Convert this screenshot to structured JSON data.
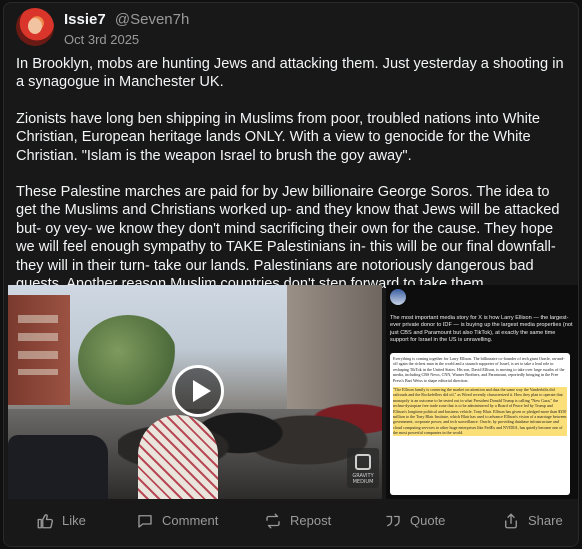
{
  "post": {
    "author": {
      "display_name": "Issie7",
      "handle": "@Seven7h",
      "date": "Oct 3rd 2025",
      "avatar_icon": "profile-avatar"
    },
    "paragraphs": [
      "In Brooklyn, mobs are hunting Jews and attacking them. Just yesterday a shooting in a synagogue in Manchester UK.",
      "Zionists have long ben shipping in Muslims from poor, troubled nations into White Christian, European heritage lands ONLY. With a view to genocide for the White Christian. \"Islam is the weapon Israel to brush the goy away\".",
      "These Palestine marches are paid for by Jew billionaire George Soros. The idea to get the Muslims and Christians worked up- and they know that Jews will be attacked but- oy vey- we know they don't mind sacrificing their own for the cause. They hope we will feel enough sympathy to TAKE Palestinians in- this will be our final downfall- they will in their turn- take our lands. Palestinians are notoriously dangerous bad guests. Another reason Muslim countries don't step forward to take them."
    ]
  },
  "media": {
    "video": {
      "play_icon": "play-icon",
      "watermark_text": "GRAVITY MEDIUM"
    },
    "screenshot": {
      "lead": "The most important media story for X is how Larry Ellison — the largest-ever private donor to IDF — is buying up the largest media properties (not just CBS and Paramount but also TikTok), at exactly the same time support for Israel in the US is unravelling.",
      "card_paragraphs": [
        "Everything is coming together for Larry Ellison. The billionaire co-founder of tech giant Oracle, on-and-off again the richest man in the world and a staunch supporter of Israel, is set to take a lead role in reshaping TikTok in the United States. His son, David Ellison, is moving to take over large swaths of the media, including CBS News, CNN, Warner Brothers, and Paramount, reportedly bringing in the Free Press's Bari Weiss to shape editorial direction.",
        "\"The Ellison family is cornering the market on attention and data the same way the Vanderbilts did railroads and the Rockefellers did oil,\" as Wired recently characterized it. How they plan to operate that monopoly is an outcome to be tested out in what President Donald Trump is calling \"New Gaza,\" the techno-dystopian free trade zone that is to be administered by a Board of Peace led by Trump and Ellison's longtime political and business vehicle. Tony Blair. Ellison has given or pledged more than $350 million to the Tony Blair Institute, which Blair has used to advance Ellison's vision of a marriage between government, corporate power, and tech surveillance. Oracle, by providing database infrastructure and cloud computing services to other huge enterprises like FedEx and NVIDIA, has quietly become one of the most powerful companies in the world."
      ]
    }
  },
  "actions": [
    {
      "label": "Like",
      "icon": "thumbs-up-icon"
    },
    {
      "label": "Comment",
      "icon": "comment-icon"
    },
    {
      "label": "Repost",
      "icon": "repost-icon"
    },
    {
      "label": "Quote",
      "icon": "quote-icon"
    },
    {
      "label": "Share",
      "icon": "share-icon"
    }
  ],
  "colors": {
    "background": "#181818",
    "text": "#f3f5f7",
    "muted": "#9a9a9a",
    "highlight": "#fbe07a"
  }
}
